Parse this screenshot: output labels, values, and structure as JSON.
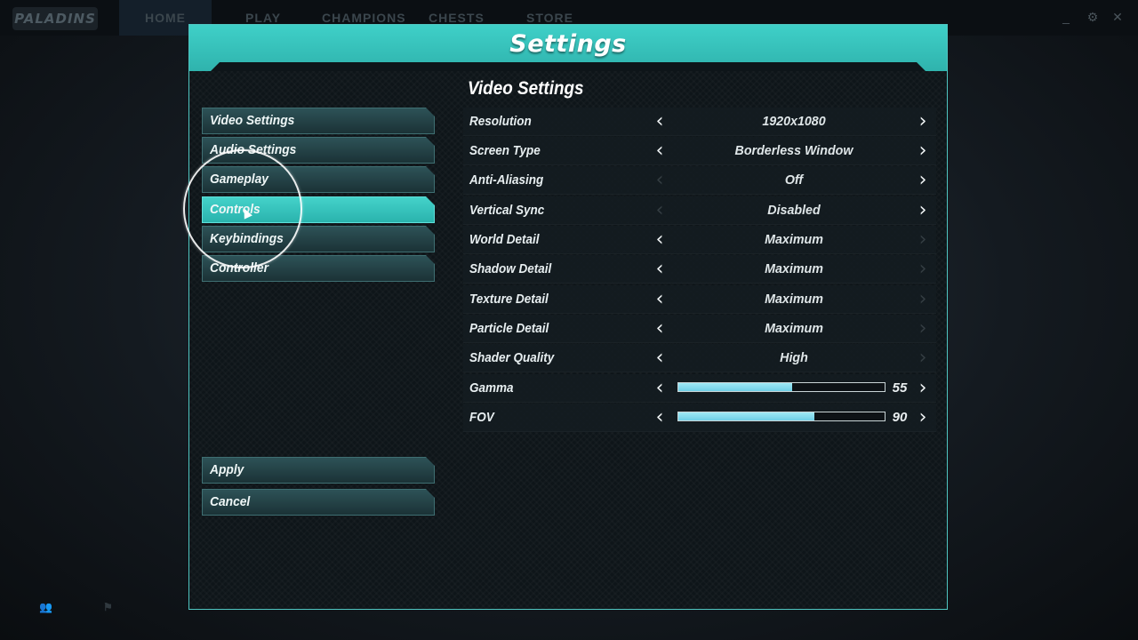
{
  "top_nav": {
    "logo_text": "PALADINS",
    "items": [
      {
        "label": "HOME"
      },
      {
        "label": "PLAY"
      },
      {
        "label": "CHAMPIONS"
      },
      {
        "label": "CHESTS"
      },
      {
        "label": "STORE"
      }
    ]
  },
  "modal": {
    "title": "Settings",
    "menu": [
      {
        "label": "Video Settings",
        "active": false
      },
      {
        "label": "Audio Settings",
        "active": false
      },
      {
        "label": "Gameplay",
        "active": false
      },
      {
        "label": "Controls",
        "active": true
      },
      {
        "label": "Keybindings",
        "active": false
      },
      {
        "label": "Controller",
        "active": false
      }
    ],
    "apply_label": "Apply",
    "cancel_label": "Cancel",
    "section_title": "Video Settings",
    "settings": [
      {
        "label": "Resolution",
        "value": "1920x1080",
        "left_enabled": true,
        "right_enabled": true
      },
      {
        "label": "Screen Type",
        "value": "Borderless Window",
        "left_enabled": true,
        "right_enabled": true
      },
      {
        "label": "Anti-Aliasing",
        "value": "Off",
        "left_enabled": false,
        "right_enabled": true
      },
      {
        "label": "Vertical Sync",
        "value": "Disabled",
        "left_enabled": false,
        "right_enabled": true
      },
      {
        "label": "World Detail",
        "value": "Maximum",
        "left_enabled": true,
        "right_enabled": false
      },
      {
        "label": "Shadow Detail",
        "value": "Maximum",
        "left_enabled": true,
        "right_enabled": false
      },
      {
        "label": "Texture Detail",
        "value": "Maximum",
        "left_enabled": true,
        "right_enabled": false
      },
      {
        "label": "Particle Detail",
        "value": "Maximum",
        "left_enabled": true,
        "right_enabled": false
      },
      {
        "label": "Shader Quality",
        "value": "High",
        "left_enabled": true,
        "right_enabled": false
      }
    ],
    "sliders": [
      {
        "label": "Gamma",
        "value": "55",
        "fraction": 0.55
      },
      {
        "label": "FOV",
        "value": "90",
        "fraction": 0.66
      }
    ]
  },
  "colors": {
    "accent": "#3fd0c8",
    "slider_fill": "#8fdff0"
  }
}
